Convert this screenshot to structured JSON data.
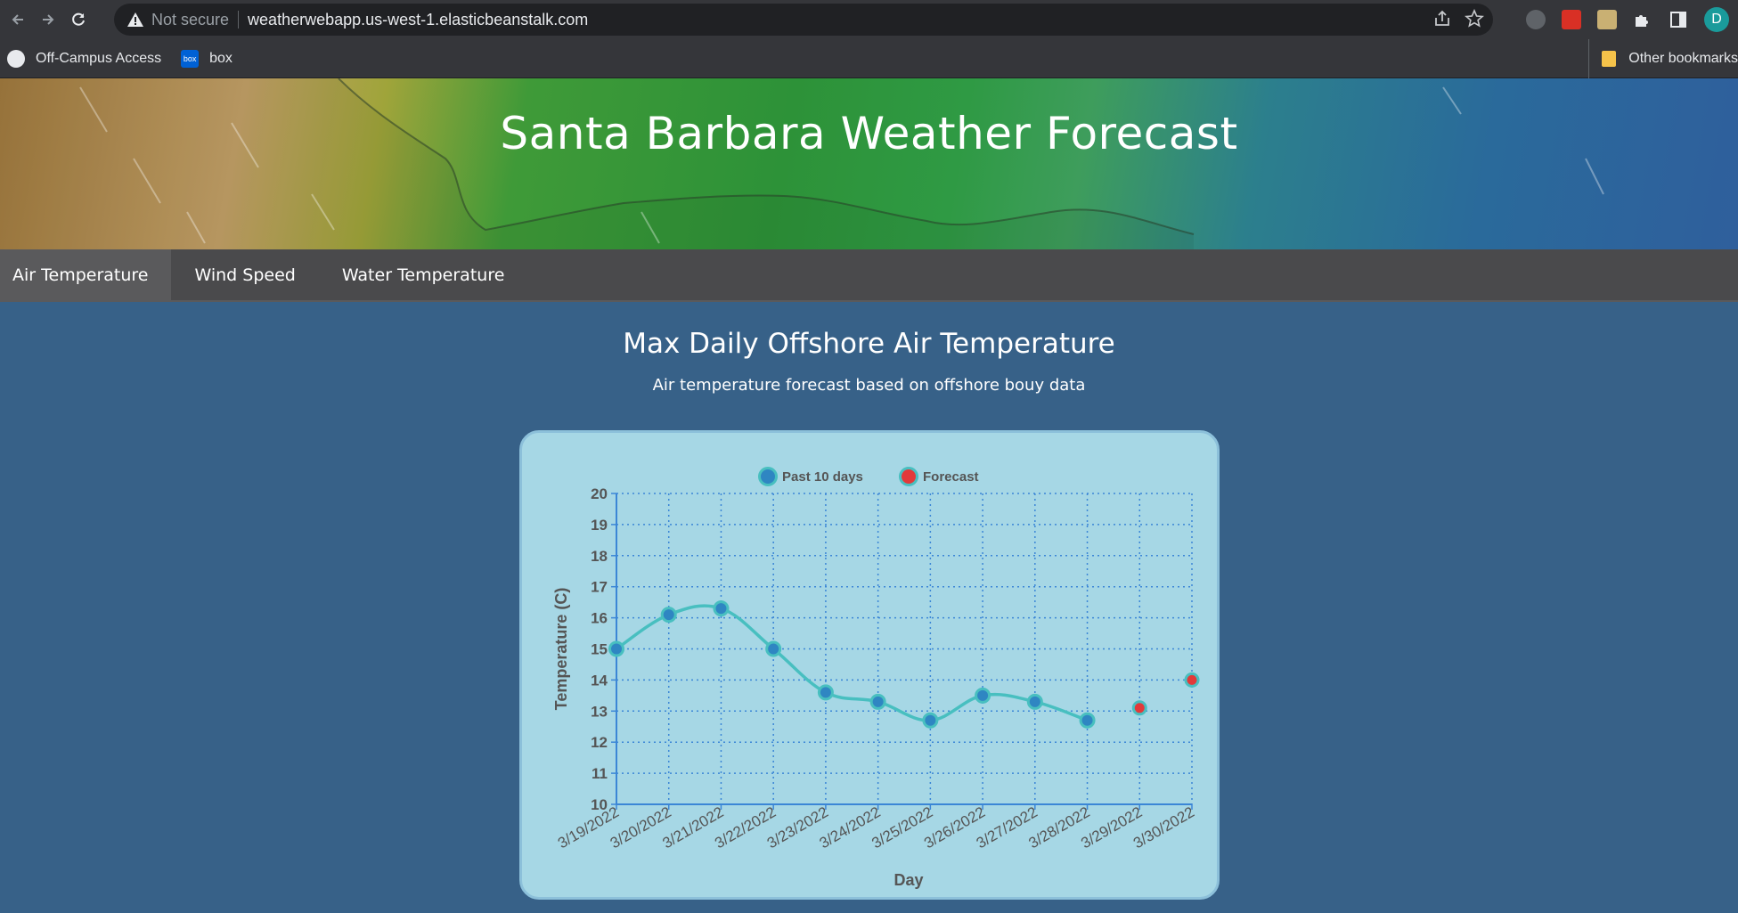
{
  "browser": {
    "security_label": "Not secure",
    "url": "weatherwebapp.us-west-1.elasticbeanstalk.com",
    "profile_initial": "D",
    "bookmarks": [
      {
        "label": "Off-Campus Access",
        "icon": "globe-icon"
      },
      {
        "label": "box",
        "icon": "box-icon",
        "icon_text": "box"
      }
    ],
    "other_bookmarks": "Other bookmarks"
  },
  "header": {
    "title": "Santa Barbara Weather Forecast"
  },
  "tabs": [
    {
      "label": "Air Temperature",
      "active": true
    },
    {
      "label": "Wind Speed",
      "active": false
    },
    {
      "label": "Water Temperature",
      "active": false
    }
  ],
  "main": {
    "title": "Max Daily Offshore Air Temperature",
    "subtitle": "Air temperature forecast based on offshore bouy data"
  },
  "colors": {
    "page_bg": "#376188",
    "card_bg": "#a6d7e5",
    "line": "#48bfc0",
    "past_point": "#2f86c2",
    "forecast_point": "#e23a3a",
    "grid": "#3b86d6"
  },
  "chart_data": {
    "type": "line",
    "xlabel": "Day",
    "ylabel": "Temperature (C)",
    "ylim": [
      10,
      20
    ],
    "yticks": [
      10,
      11,
      12,
      13,
      14,
      15,
      16,
      17,
      18,
      19,
      20
    ],
    "categories": [
      "3/19/2022",
      "3/20/2022",
      "3/21/2022",
      "3/22/2022",
      "3/23/2022",
      "3/24/2022",
      "3/25/2022",
      "3/26/2022",
      "3/27/2022",
      "3/28/2022",
      "3/29/2022",
      "3/30/2022"
    ],
    "grid": true,
    "legend_position": "top",
    "series": [
      {
        "name": "Past 10 days",
        "values": [
          15.0,
          16.1,
          16.3,
          15.0,
          13.6,
          13.3,
          12.7,
          13.5,
          13.3,
          12.7,
          null,
          null
        ]
      },
      {
        "name": "Forecast",
        "values": [
          null,
          null,
          null,
          null,
          null,
          null,
          null,
          null,
          null,
          null,
          13.1,
          14.0
        ]
      }
    ]
  }
}
